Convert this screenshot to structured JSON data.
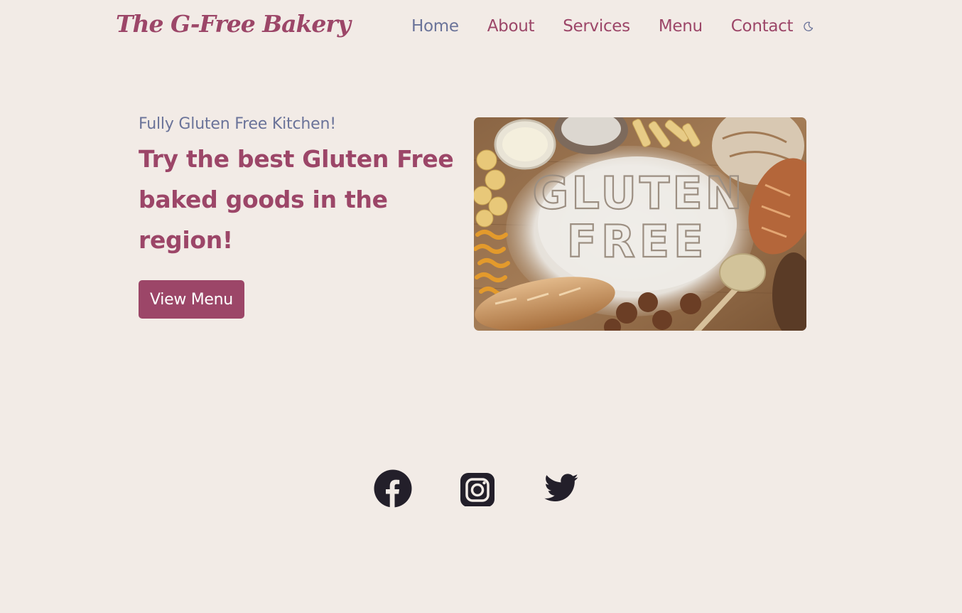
{
  "brand": {
    "logo_text": "The G-Free Bakery",
    "accent_color": "#9c4668",
    "secondary_color": "#6a7399",
    "background_color": "#f2ebe6"
  },
  "nav": {
    "items": [
      {
        "label": "Home",
        "active": true
      },
      {
        "label": "About"
      },
      {
        "label": "Services"
      },
      {
        "label": "Menu"
      },
      {
        "label": "Contact"
      }
    ],
    "theme_toggle_icon": "moon-icon"
  },
  "hero": {
    "eyebrow": "Fully Gluten Free Kitchen!",
    "headline": "Try the best Gluten Free baked goods in the region!",
    "cta_label": "View Menu",
    "image_text_line1": "GLUTEN",
    "image_text_line2": "FREE"
  },
  "social": {
    "icons": [
      "facebook-icon",
      "instagram-icon",
      "twitter-icon"
    ]
  }
}
